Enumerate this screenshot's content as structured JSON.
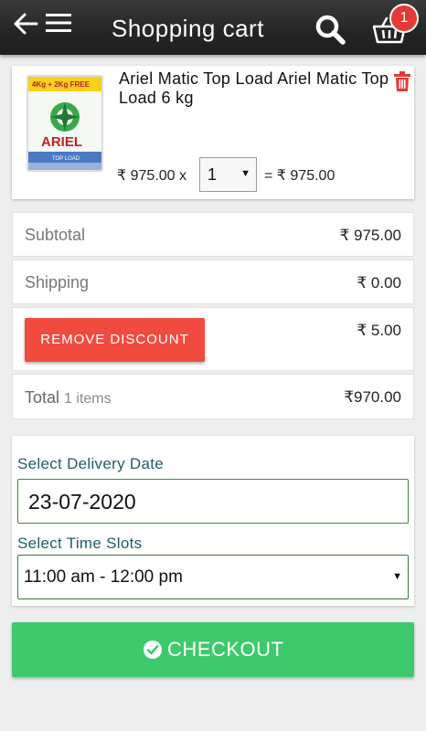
{
  "header": {
    "title": "Shopping cart",
    "cart_count": "1",
    "icons": [
      "back-arrow-icon",
      "menu-icon",
      "search-icon",
      "cart-icon"
    ]
  },
  "product": {
    "name": "Ariel Matic Top Load Ariel Matic Top Load 6 kg",
    "unit_price": "₹ 975.00 x",
    "quantity": "1",
    "line_total": "= ₹ 975.00",
    "image_brand": "ARIEL",
    "image_promo": "4Kg + 2Kg FREE",
    "image_variant": "TOP LOAD"
  },
  "summary": {
    "subtotal_label": "Subtotal",
    "subtotal_value": "₹ 975.00",
    "shipping_label": "Shipping",
    "shipping_value": "₹ 0.00",
    "discount_button": "REMOVE DISCOUNT",
    "discount_value": "₹ 5.00",
    "total_label": "Total",
    "total_items": "1 items",
    "total_value": "₹970.00"
  },
  "delivery": {
    "date_label": "Select Delivery Date",
    "date_value": "23-07-2020",
    "slot_label": "Select Time Slots",
    "slot_value": "11:00 am - 12:00 pm"
  },
  "checkout": {
    "label": "CHECKOUT"
  },
  "colors": {
    "header_bg": "#262626",
    "badge": "#e53935",
    "discount_btn": "#f14b3f",
    "checkout_btn": "#3ec96d",
    "trash": "#e53935",
    "field_label": "#1e5e66"
  }
}
